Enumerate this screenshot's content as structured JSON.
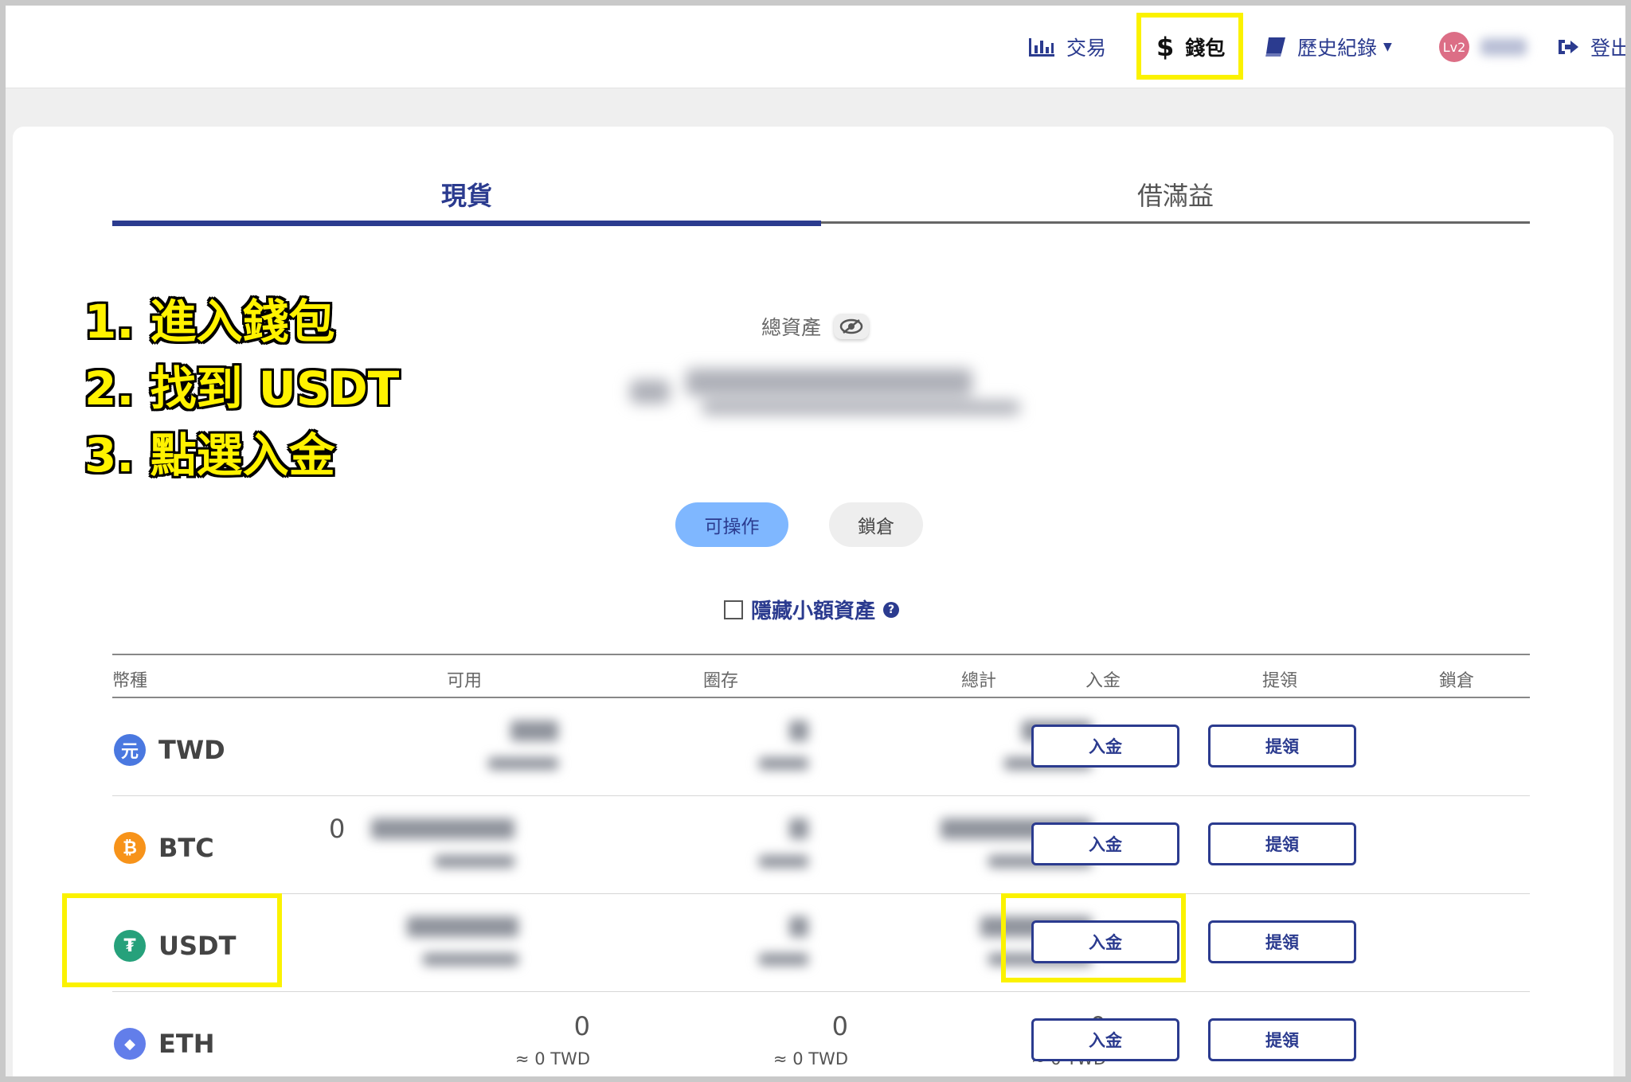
{
  "nav": {
    "trade": "交易",
    "wallet": "錢包",
    "history": "歷史紀錄",
    "level": "Lv2",
    "logout": "登出"
  },
  "tabs": {
    "spot": "現貨",
    "margin": "借滿益"
  },
  "instructions": [
    "1. 進入錢包",
    "2. 找到 USDT",
    "3. 點選入金"
  ],
  "summary": {
    "total_label": "總資產"
  },
  "filters": {
    "available": "可操作",
    "locked": "鎖倉"
  },
  "hide_small": "隱藏小額資產",
  "hide_small_help": "?",
  "table": {
    "headers": {
      "coin": "幣種",
      "available": "可用",
      "hold": "圈存",
      "total": "總計",
      "deposit": "入金",
      "withdraw": "提領",
      "lock": "鎖倉"
    },
    "rows": [
      {
        "symbol": "TWD",
        "icon": "元",
        "deposit": "入金",
        "withdraw": "提領"
      },
      {
        "symbol": "BTC",
        "icon": "₿",
        "prefix_zero": "0",
        "deposit": "入金",
        "withdraw": "提領"
      },
      {
        "symbol": "USDT",
        "icon": "₮",
        "deposit": "入金",
        "withdraw": "提領"
      },
      {
        "symbol": "ETH",
        "icon": "◆",
        "available": "0",
        "available_twd": "≈ 0 TWD",
        "hold": "0",
        "hold_twd": "≈ 0 TWD",
        "total": "0",
        "total_twd": "≈ 0 TWD",
        "deposit": "入金",
        "withdraw": "提領"
      }
    ]
  },
  "colors": {
    "brand": "#2b3b8f",
    "highlight": "#fff200",
    "pill_active": "#7fb7ff",
    "twd": "#4a78e0",
    "btc": "#f7931a",
    "usdt": "#26a17b",
    "eth": "#627eea"
  }
}
